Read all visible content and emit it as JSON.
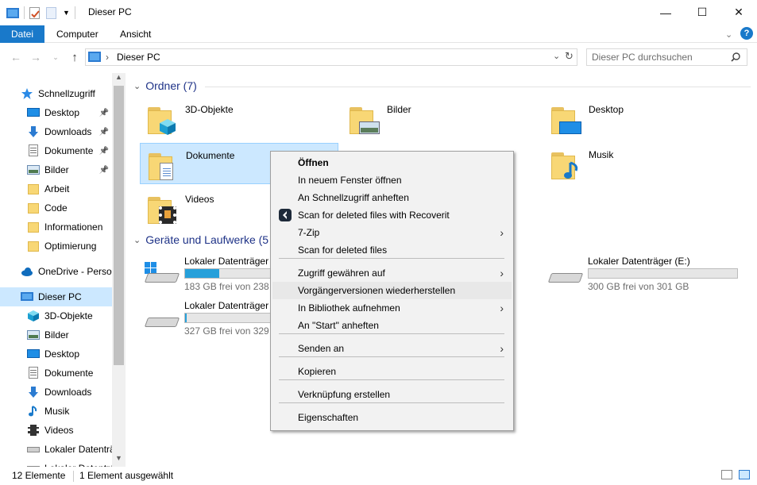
{
  "window": {
    "title": "Dieser PC",
    "minimize": "—",
    "maximize": "☐",
    "close": "✕"
  },
  "ribbon": {
    "tabs": [
      "Datei",
      "Computer",
      "Ansicht"
    ],
    "help": "?"
  },
  "address": {
    "path": "Dieser PC",
    "separator": "›",
    "search_placeholder": "Dieser PC durchsuchen"
  },
  "nav": {
    "items": [
      {
        "label": "Schnellzugriff",
        "icon": "star-icon"
      },
      {
        "label": "Desktop",
        "icon": "desktop-icon",
        "pinned": true
      },
      {
        "label": "Downloads",
        "icon": "download-icon",
        "pinned": true
      },
      {
        "label": "Dokumente",
        "icon": "documents-icon",
        "pinned": true
      },
      {
        "label": "Bilder",
        "icon": "pictures-icon",
        "pinned": true
      },
      {
        "label": "Arbeit",
        "icon": "folder-icon"
      },
      {
        "label": "Code",
        "icon": "folder-icon"
      },
      {
        "label": "Informationen",
        "icon": "folder-icon"
      },
      {
        "label": "Optimierung",
        "icon": "folder-icon"
      },
      {
        "label": "OneDrive - Persor",
        "icon": "cloud-icon"
      },
      {
        "label": "Dieser PC",
        "icon": "computer-icon"
      },
      {
        "label": "3D-Objekte",
        "icon": "cube-icon"
      },
      {
        "label": "Bilder",
        "icon": "pictures-icon"
      },
      {
        "label": "Desktop",
        "icon": "desktop-icon"
      },
      {
        "label": "Dokumente",
        "icon": "documents-icon"
      },
      {
        "label": "Downloads",
        "icon": "download-icon"
      },
      {
        "label": "Musik",
        "icon": "music-icon"
      },
      {
        "label": "Videos",
        "icon": "video-icon"
      },
      {
        "label": "Lokaler Datenträ",
        "icon": "drive-icon"
      },
      {
        "label": "Lokaler Datentrá",
        "icon": "drive-icon"
      }
    ]
  },
  "folders_group": {
    "title": "Ordner (7)",
    "items": [
      "3D-Objekte",
      "Bilder",
      "Desktop",
      "Dokumente",
      "Musik",
      "Videos"
    ]
  },
  "drives_group": {
    "title": "Geräte und Laufwerke (5",
    "drives": [
      {
        "label": "Lokaler Datenträger (",
        "free": "183 GB frei von 238 G",
        "used_fraction": 0.23
      },
      {
        "label": "Lokaler Datenträger (E:)",
        "free": "300 GB frei von 301 GB",
        "used_fraction": 0.0
      },
      {
        "label": "Lokaler Datenträger (",
        "free": "327 GB frei von 329 G",
        "used_fraction": 0.01
      }
    ]
  },
  "context_menu": {
    "items": [
      {
        "label": "Öffnen",
        "bold": true
      },
      {
        "label": "In neuem Fenster öffnen"
      },
      {
        "label": "An Schnellzugriff anheften"
      },
      {
        "label": "Scan for deleted files with Recoverit",
        "icon": "recoverit-icon"
      },
      {
        "label": "7-Zip",
        "submenu": true
      },
      {
        "label": "Scan for deleted files"
      },
      {
        "label": "Zugriff gewähren auf",
        "submenu": true
      },
      {
        "label": "Vorgängerversionen wiederherstellen",
        "hover": true
      },
      {
        "label": "In Bibliothek aufnehmen",
        "submenu": true
      },
      {
        "label": "An \"Start\" anheften"
      },
      {
        "label": "Senden an",
        "submenu": true
      },
      {
        "label": "Kopieren"
      },
      {
        "label": "Verknüpfung erstellen"
      },
      {
        "label": "Eigenschaften"
      }
    ],
    "submenu_arrow": "›"
  },
  "status": {
    "count": "12 Elemente",
    "selected": "1 Element ausgewählt"
  },
  "colors": {
    "accent": "#1979ca",
    "selection": "#cce8ff",
    "group_header": "#1e3287",
    "bar_fill": "#26a0da"
  }
}
